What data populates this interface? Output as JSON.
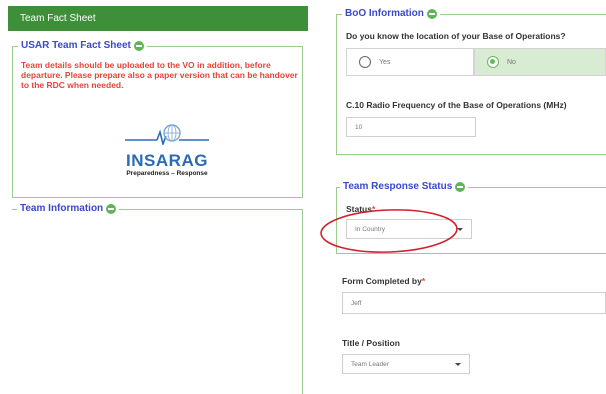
{
  "left_panel": {
    "title": "Team Fact Sheet",
    "fact_sheet": {
      "legend": "USAR Team Fact Sheet",
      "warning": "Team details should be uploaded to the VO in addition, before departure. Please prepare also a paper version that can be handover to the RDC when needed.",
      "logo": {
        "wordmark": "INSARAG",
        "tagline": "Preparedness – Response"
      }
    },
    "team_information": {
      "legend": "Team Information"
    }
  },
  "right_panel": {
    "bo_information": {
      "legend": "BoO Information",
      "question": "Do you know the location of your Base of Operations?",
      "options": [
        {
          "label": "Yes",
          "selected": false
        },
        {
          "label": "No",
          "selected": true
        }
      ],
      "radio_freq_label": "C.10 Radio Frequency of the Base of Operations (MHz)",
      "radio_freq_value": "10"
    },
    "team_response_status": {
      "legend": "Team Response Status",
      "status_label": "Status",
      "status_required": "*",
      "status_value": "In Country"
    },
    "form_completed_by": {
      "label": "Form Completed by",
      "required": "*",
      "value": "Jeff"
    },
    "title_position": {
      "label": "Title / Position",
      "value": "Team Leader"
    }
  },
  "colors": {
    "green_header": "#3f8f3a",
    "legend_blue": "#3949c8",
    "warning_red": "#e8443a",
    "annotation_red": "#d3202a",
    "selected_green": "#d7ecd3"
  }
}
